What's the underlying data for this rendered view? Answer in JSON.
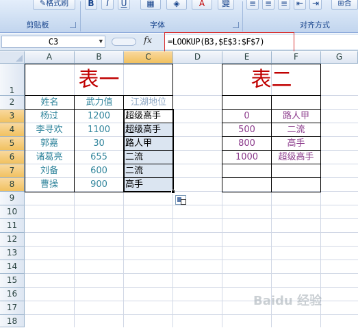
{
  "ribbon": {
    "clipboard_group": "剪贴板",
    "font_group": "字体",
    "align_group": "对齐方式",
    "format_painter": "格式刷",
    "bold": "B",
    "italic": "I",
    "underline": "U",
    "font_color": "A",
    "phonetic": "變",
    "merge_fragment": "合"
  },
  "formula_bar": {
    "name_box": "C3",
    "fx": "fx",
    "formula": "=LOOKUP(B3,$E$3:$F$7)"
  },
  "columns": [
    "A",
    "B",
    "C",
    "D",
    "E",
    "F",
    "G"
  ],
  "rows": [
    "1",
    "2",
    "3",
    "4",
    "5",
    "6",
    "7",
    "8",
    "9",
    "10",
    "11",
    "12",
    "13",
    "14",
    "15",
    "16",
    "17",
    "18"
  ],
  "table1": {
    "title": "表一",
    "headers": [
      "姓名",
      "武力值",
      "江湖地位"
    ],
    "rows": [
      [
        "杨过",
        "1200",
        "超级高手"
      ],
      [
        "李寻欢",
        "1100",
        "超级高手"
      ],
      [
        "郭嘉",
        "30",
        "路人甲"
      ],
      [
        "诸葛亮",
        "655",
        "二流"
      ],
      [
        "刘备",
        "600",
        "二流"
      ],
      [
        "曹操",
        "900",
        "高手"
      ]
    ]
  },
  "table2": {
    "title": "表二",
    "rows": [
      [
        "0",
        "路人甲"
      ],
      [
        "500",
        "二流"
      ],
      [
        "800",
        "高手"
      ],
      [
        "1000",
        "超级高手"
      ]
    ]
  },
  "watermark": "Baidu 经验",
  "colors": {
    "accent_red": "#c00000",
    "teal_text": "#31859c",
    "selection_header": "#f1c15f"
  }
}
